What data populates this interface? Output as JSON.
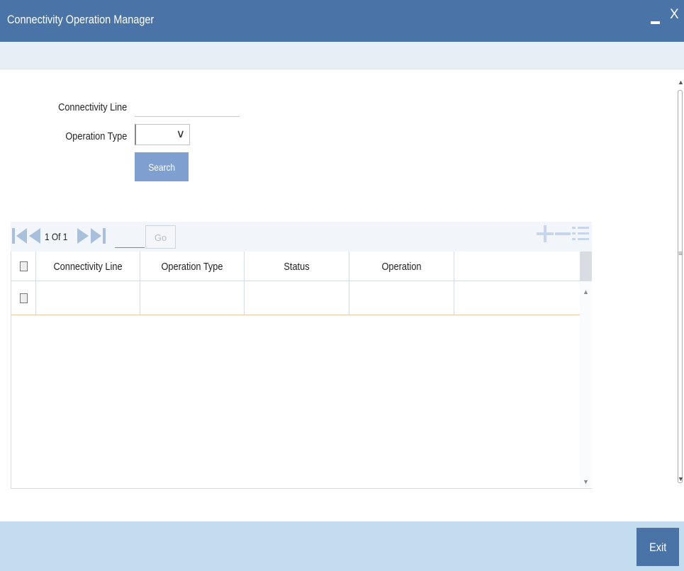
{
  "window": {
    "title": "Connectivity Operation Manager",
    "minimize_glyph": "▬",
    "close_glyph": "X"
  },
  "form": {
    "connectivity_line_label": "Connectivity Line",
    "connectivity_line_value": "",
    "operation_type_label": "Operation Type",
    "operation_type_value": "",
    "search_label": "Search"
  },
  "pager": {
    "page_text": "1 Of 1",
    "go_label": "Go",
    "page_input_value": ""
  },
  "table": {
    "columns": [
      "Connectivity Line",
      "Operation Type",
      "Status",
      "Operation"
    ],
    "rows": [
      [
        "",
        "",
        "",
        ""
      ]
    ]
  },
  "footer": {
    "exit_label": "Exit"
  },
  "icons": {
    "first_page": "first-page-icon",
    "prev_page": "previous-page-icon",
    "next_page": "next-page-icon",
    "last_page": "last-page-icon",
    "add_row": "add-row-icon",
    "delete_row": "delete-row-icon",
    "single_view": "single-view-icon"
  },
  "colors": {
    "title_bar": "#4a74a8",
    "footer": "#c4dcef",
    "search_button": "#7e9fcf",
    "exit_button": "#4a74a8"
  }
}
